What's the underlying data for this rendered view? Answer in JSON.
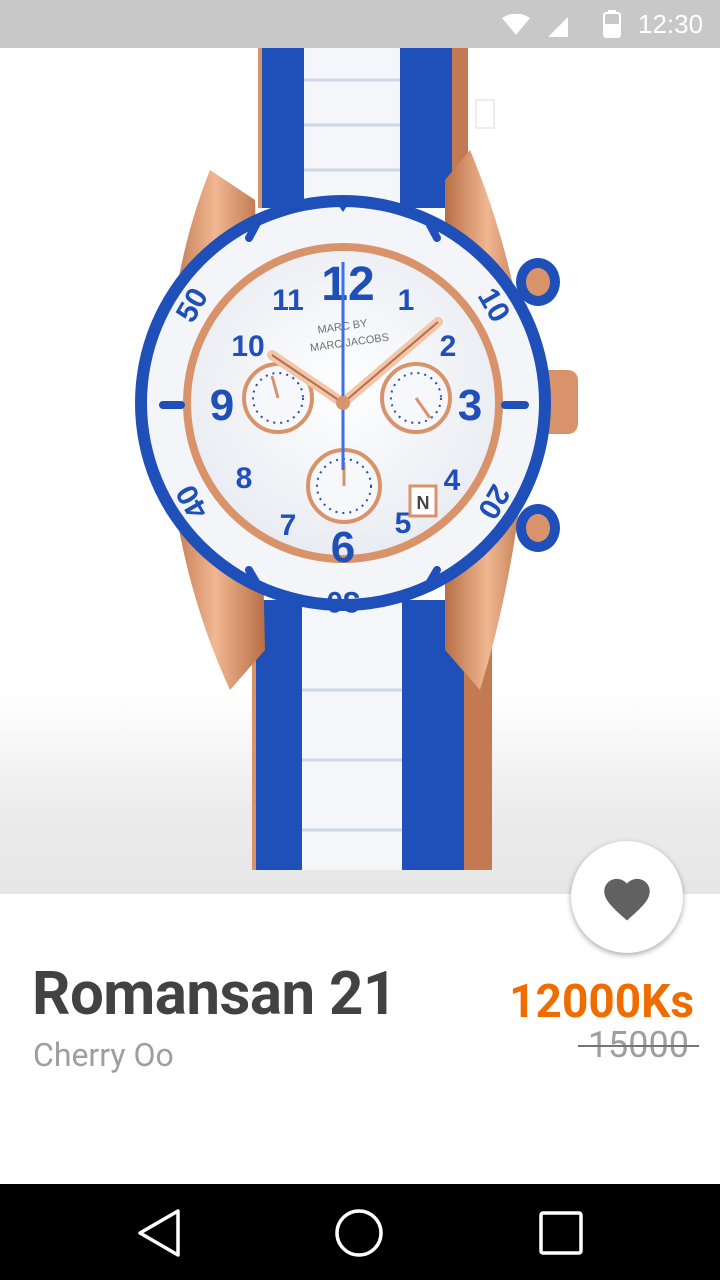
{
  "status_bar": {
    "time": "12:30",
    "icons": [
      "wifi-icon",
      "signal-icon",
      "battery-icon"
    ]
  },
  "product": {
    "name": "Romansan 21",
    "seller": "Cherry Oo",
    "price": "12000Ks",
    "original_price": "15000",
    "image_description_icon": "watch-product-image",
    "dial_numbers": [
      "12",
      "1",
      "2",
      "3",
      "4",
      "5",
      "6",
      "7",
      "8",
      "9",
      "10",
      "11"
    ],
    "bezel_numbers": [
      "10",
      "20",
      "30",
      "40",
      "50"
    ],
    "brand_text": [
      "MARC BY",
      "MARC JACOBS"
    ],
    "date_window": "N"
  },
  "favorite": {
    "icon": "heart-icon"
  },
  "nav_bar": {
    "buttons": [
      "back-icon",
      "home-icon",
      "recents-icon"
    ]
  },
  "colors": {
    "accent_price": "#ef6c00",
    "watch_blue": "#1f4fb8",
    "rose_gold": "#d9936a",
    "status_bar_bg": "#c8c8c8",
    "nav_bar_bg": "#000000"
  }
}
